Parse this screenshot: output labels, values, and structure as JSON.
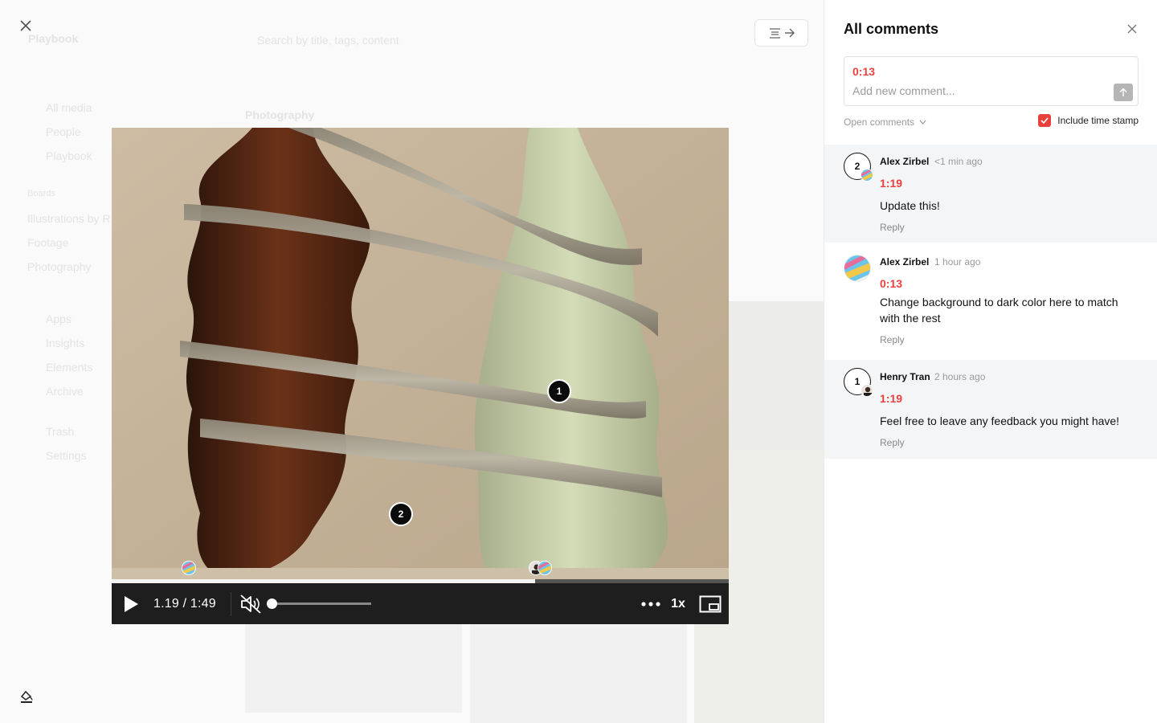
{
  "background_app": {
    "workspace": "Playbook",
    "search_placeholder": "Search by title, tags, content",
    "section_title": "Photography",
    "nav": [
      "All media",
      "People",
      "Playbook"
    ],
    "boards_label": "Boards",
    "boards": [
      "Illustrations by R",
      "Footage",
      "Photography"
    ],
    "more_nav": [
      "Apps",
      "Insights",
      "Elements",
      "Archive",
      "Trash",
      "Settings"
    ]
  },
  "viewer": {
    "close_icon": "close-icon",
    "panel_toggle_icon": "panel-toggle-icon",
    "paint_icon": "paint-bucket-icon"
  },
  "player": {
    "pins": [
      {
        "label": "1"
      },
      {
        "label": "2"
      }
    ],
    "time_display": "1.19 / 1:49",
    "progress_fraction": 0.686,
    "volume_fraction": 0.0,
    "muted": true,
    "speed": "1x",
    "icons": {
      "play": "play-icon",
      "mute": "volume-muted-icon",
      "more": "more-dots-icon",
      "pip": "picture-in-picture-icon"
    }
  },
  "comments_panel": {
    "title": "All comments",
    "composer": {
      "timestamp": "0:13",
      "placeholder": "Add new comment..."
    },
    "filter_label": "Open comments",
    "include_timestamp_label": "Include time stamp",
    "include_timestamp_checked": true,
    "accent_color": "#e8413e",
    "reply_label": "Reply",
    "comments": [
      {
        "pin": "2",
        "author": "Alex Zirbel",
        "time": "<1 min ago",
        "timestamp": "1:19",
        "text": "Update this!"
      },
      {
        "author": "Alex Zirbel",
        "time": "1 hour ago",
        "timestamp": "0:13",
        "text": "Change background to dark color here to match with the rest"
      },
      {
        "pin": "1",
        "author": "Henry Tran",
        "time": "2 hours ago",
        "timestamp": "1:19",
        "text": "Feel free to leave any feedback you might have!"
      }
    ]
  }
}
